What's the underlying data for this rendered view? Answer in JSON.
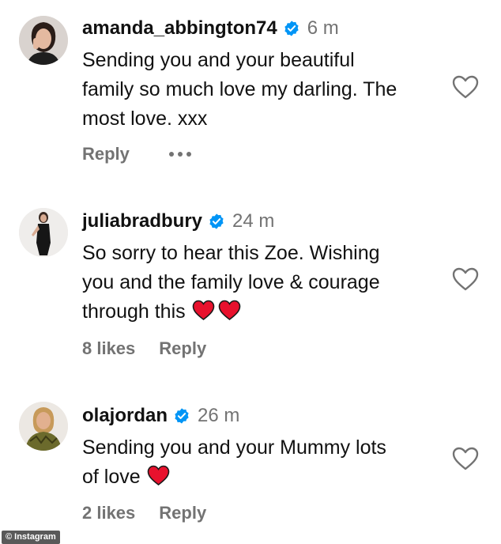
{
  "comments": [
    {
      "username": "amanda_abbington74",
      "time": "6 m",
      "lines": [
        "Sending you and your beautiful",
        "family so much love my darling. The",
        "most love. xxx"
      ],
      "likes": "",
      "reply_label": "Reply",
      "avatar_icon": "avatar-woman-dark-hair",
      "verified_icon": "verified-badge-icon",
      "like_icon": "heart-outline-icon",
      "more_icon": "ellipsis-icon"
    },
    {
      "username": "juliabradbury",
      "time": "24 m",
      "lines": [
        "So sorry to hear this Zoe. Wishing",
        "you and the family love & courage",
        "through this"
      ],
      "emoji": [
        "red-heart",
        "red-heart"
      ],
      "likes": "8 likes",
      "reply_label": "Reply",
      "avatar_icon": "avatar-woman-black-dress",
      "verified_icon": "verified-badge-icon",
      "like_icon": "heart-outline-icon"
    },
    {
      "username": "olajordan",
      "time": "26 m",
      "lines": [
        "Sending you and your Mummy lots",
        "of love"
      ],
      "emoji": [
        "red-heart"
      ],
      "likes": "2 likes",
      "reply_label": "Reply",
      "avatar_icon": "avatar-woman-blonde",
      "verified_icon": "verified-badge-icon",
      "like_icon": "heart-outline-icon"
    }
  ],
  "watermark": "© Instagram",
  "colors": {
    "text": "#111111",
    "secondary": "#737373",
    "verified": "#0095f6",
    "heart_emoji": "#e8112d"
  }
}
